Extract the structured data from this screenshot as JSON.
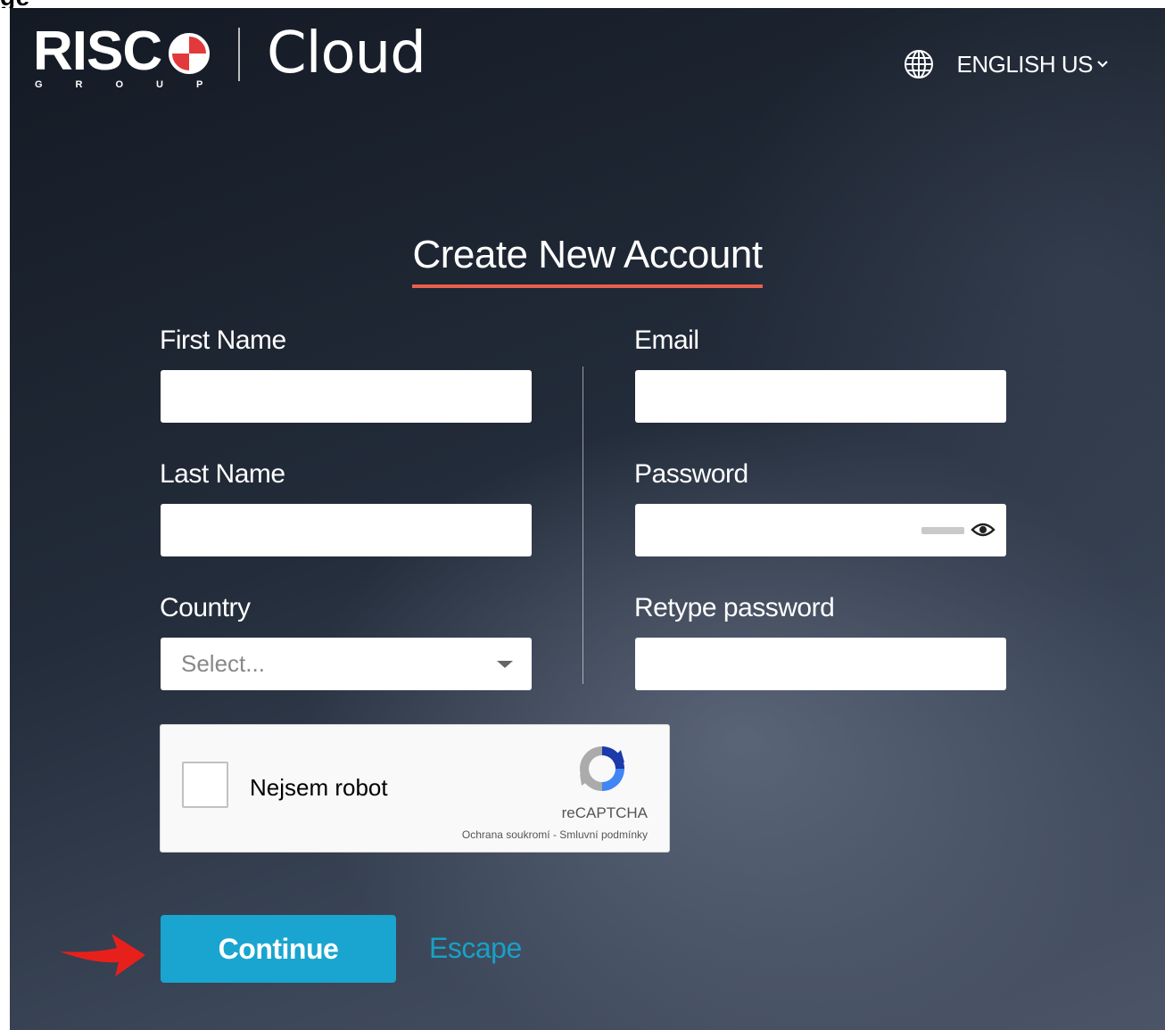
{
  "caption_fragment": "ge",
  "header": {
    "logo_text": "RISC",
    "logo_group": "GROUP",
    "product": "Cloud",
    "language": "ENGLISH US"
  },
  "form": {
    "title": "Create New Account",
    "first_name": {
      "label": "First Name",
      "value": ""
    },
    "last_name": {
      "label": "Last Name",
      "value": ""
    },
    "country": {
      "label": "Country",
      "placeholder": "Select..."
    },
    "email": {
      "label": "Email",
      "value": ""
    },
    "password": {
      "label": "Password",
      "value": ""
    },
    "retype_password": {
      "label": "Retype password",
      "value": ""
    }
  },
  "captcha": {
    "label": "Nejsem robot",
    "brand": "reCAPTCHA",
    "privacy": "Ochrana soukromí",
    "separator": " - ",
    "terms": "Smluvní podmínky"
  },
  "actions": {
    "continue": "Continue",
    "escape": "Escape"
  },
  "colors": {
    "accent": "#19a5cf",
    "underline": "#e8604c",
    "arrow": "#e8201c"
  }
}
